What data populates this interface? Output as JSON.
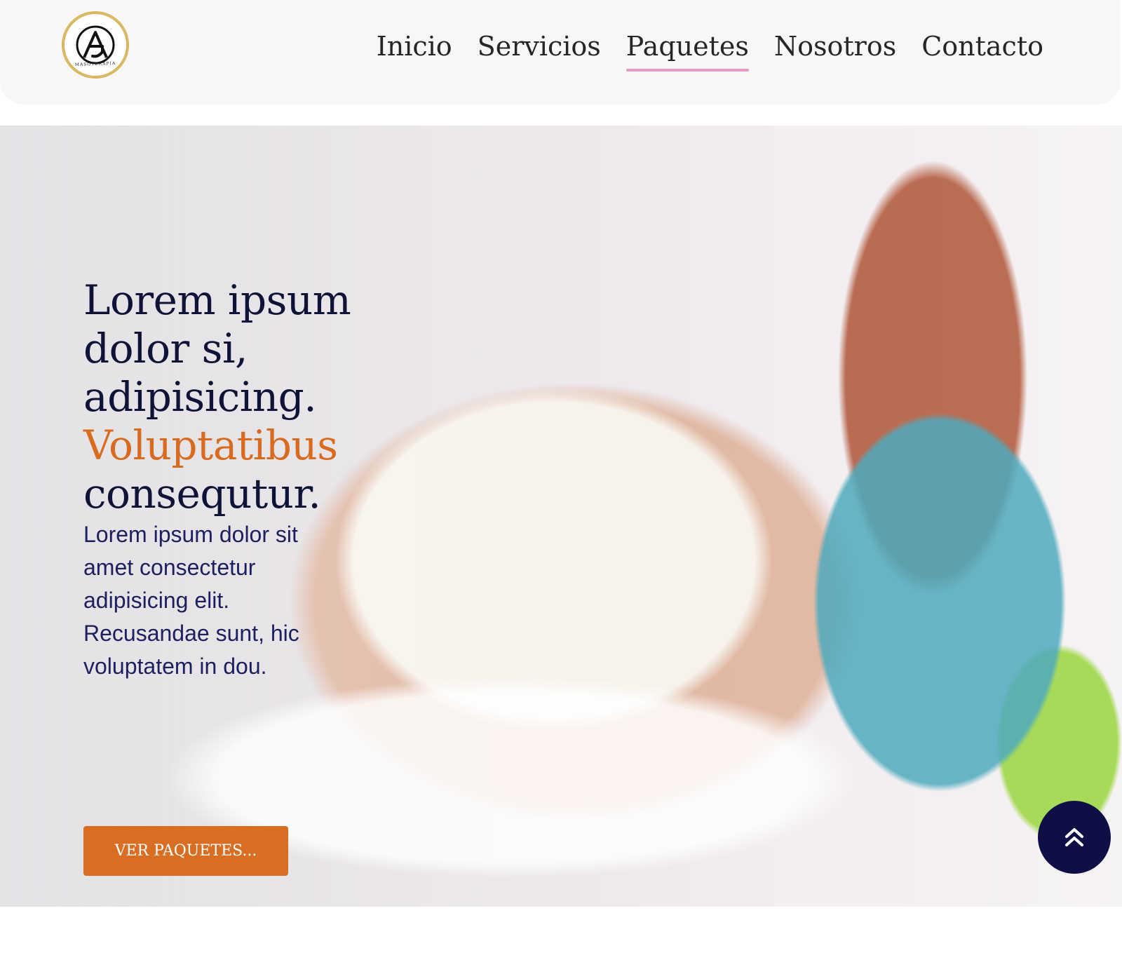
{
  "header": {
    "logo": {
      "monogram": "AG",
      "subtext": "MASOTERAPIA"
    },
    "nav": [
      {
        "label": "Inicio",
        "active": false
      },
      {
        "label": "Servicios",
        "active": false
      },
      {
        "label": "Paquetes",
        "active": true
      },
      {
        "label": "Nosotros",
        "active": false
      },
      {
        "label": "Contacto",
        "active": false
      }
    ]
  },
  "hero": {
    "title_lines": [
      "Lorem ipsum",
      "dolor si,",
      "adipisicing."
    ],
    "title_accent": "Voluptatibus",
    "title_last": "consequtur.",
    "description": "Lorem ipsum dolor sit amet consectetur adipisicing elit. Recusandae sunt, hic voluptatem in dou.",
    "cta_label": "VER PAQUETES..."
  },
  "ui": {
    "scroll_top_icon": "double-chevron-up-icon"
  },
  "colors": {
    "header_bg": "#f8f7f5",
    "nav_text": "#262626",
    "nav_active_underline": "#e79ac8",
    "title_dark": "#101338",
    "title_accent": "#d86b1f",
    "cta_bg": "#d96d22",
    "scroll_btn_bg": "#0f0f47"
  }
}
